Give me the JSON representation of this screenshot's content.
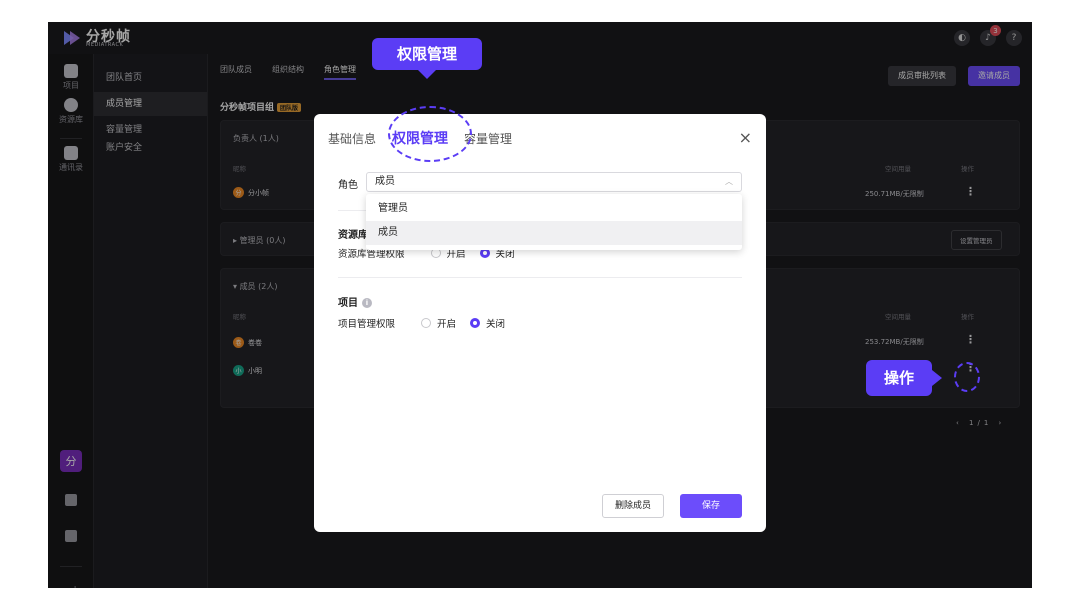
{
  "app": {
    "brand": "分秒帧",
    "brand_sub": "MEDIATRACK",
    "notification_count": "3",
    "help": "?"
  },
  "rail": {
    "items": [
      {
        "label": "项目"
      },
      {
        "label": "资源库"
      },
      {
        "label": "通讯录"
      }
    ],
    "avatar": "分",
    "collapse": "←|"
  },
  "sidenav": {
    "items": [
      "团队首页",
      "成员管理",
      "容量管理",
      "账户安全"
    ]
  },
  "tabs": [
    "团队成员",
    "组织结构",
    "角色管理"
  ],
  "header_buttons": {
    "approval_list": "成员审批列表",
    "invite": "邀请成员"
  },
  "project": {
    "title": "分秒帧项目组",
    "tag": "团队版"
  },
  "owner_panel": {
    "heading": "负责人 (1人)",
    "col_name": "昵称",
    "col_usage": "空间用量",
    "col_action": "操作",
    "rows": [
      {
        "avatar": "分",
        "name": "分小帧",
        "usage": "250.71MB/无限制",
        "color": "#f08a24"
      }
    ]
  },
  "admin_panel": {
    "heading": "管理员 (0人)",
    "set_admin": "设置管理员"
  },
  "member_panel": {
    "heading": "成员 (2人)",
    "col_name": "昵称",
    "col_usage": "空间用量",
    "col_action": "操作",
    "rows": [
      {
        "avatar": "卷",
        "name": "卷卷",
        "usage": "253.72MB/无限制",
        "color": "#f08a24"
      },
      {
        "avatar": "小",
        "name": "小明",
        "usage": "",
        "color": "#17a589"
      }
    ],
    "pager": "1/1"
  },
  "modal": {
    "tabs": [
      "基础信息",
      "权限管理",
      "容量管理"
    ],
    "close": "×",
    "role_label": "角色",
    "role_value": "成员",
    "options": [
      "管理员",
      "成员"
    ],
    "resource_title": "资源库",
    "resource_perm": "资源库管理权限",
    "project_title": "项目",
    "project_perm": "项目管理权限",
    "on": "开启",
    "off": "关闭",
    "delete_btn": "删除成员",
    "save_btn": "保存"
  },
  "callouts": {
    "perm": "权限管理",
    "action": "操作"
  },
  "colors": {
    "accent": "#5b3df5",
    "primary_button": "#6c4dfb"
  }
}
